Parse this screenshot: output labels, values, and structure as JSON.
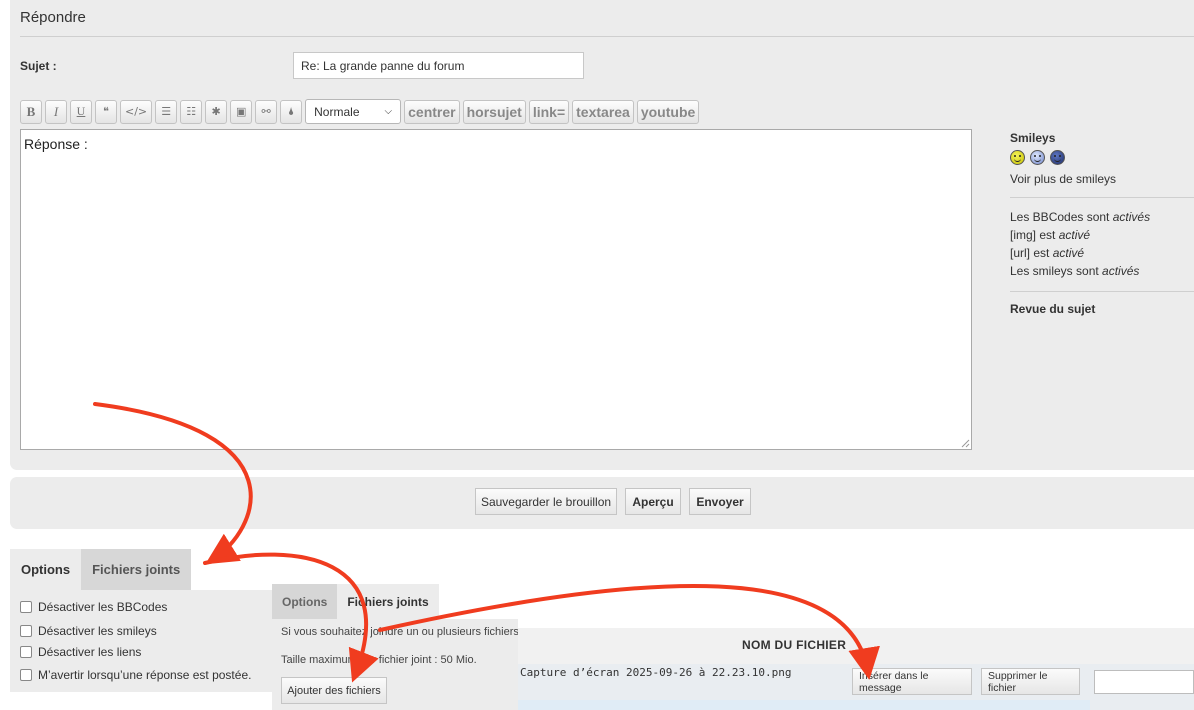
{
  "reply": {
    "title": "Répondre",
    "subject_label": "Sujet :",
    "subject_value": "Re: La grande panne du forum",
    "editor_placeholder": "Réponse :"
  },
  "toolbar": {
    "bold": "B",
    "italic": "I",
    "underline": "U",
    "quote": "❝",
    "code": "</>",
    "list": "☰",
    "olist": "☷",
    "asterisk": "✱",
    "image": "▣",
    "link": "⚯",
    "color": "🌢",
    "size_select": "Normale",
    "custom_buttons": [
      "centrer",
      "horsujet",
      "link=",
      "textarea",
      "youtube"
    ]
  },
  "sidebar": {
    "smileys_title": "Smileys",
    "more_smileys": "Voir plus de smileys",
    "bbcode_prefix": "Les BBCodes sont ",
    "bbcode_state": "activés",
    "img_prefix": "[img] est ",
    "img_state": "activé",
    "url_prefix": "[url] est ",
    "url_state": "activé",
    "smileys_prefix": "Les smileys sont ",
    "smileys_state": "activés",
    "review_title": "Revue du sujet"
  },
  "actions": {
    "save_draft": "Sauvegarder le brouillon",
    "preview": "Aperçu",
    "send": "Envoyer"
  },
  "tabs": {
    "options": "Options",
    "attachments": "Fichiers joints"
  },
  "options": {
    "disable_bbcode": "Désactiver les BBCodes",
    "disable_smileys": "Désactiver les smileys",
    "disable_links": "Désactiver les liens",
    "notify": "M’avertir lorsqu’une réponse est postée."
  },
  "attachments_panel": {
    "intro": "Si vous souhaitez joindre un ou plusieurs fichiers,",
    "max_size": "Taille maximum par fichier joint : 50 Mio.",
    "add_files": "Ajouter des fichiers",
    "file_column": "NOM DU FICHIER",
    "file_name": "Capture d’écran 2025-09-26 à 22.23.10.png",
    "insert_button": "Insérer dans le message",
    "delete_button": "Supprimer le fichier"
  },
  "colors": {
    "panel_bg": "#ececec",
    "arrow": "#f03c1f",
    "row_bg": "#e9edf1"
  }
}
